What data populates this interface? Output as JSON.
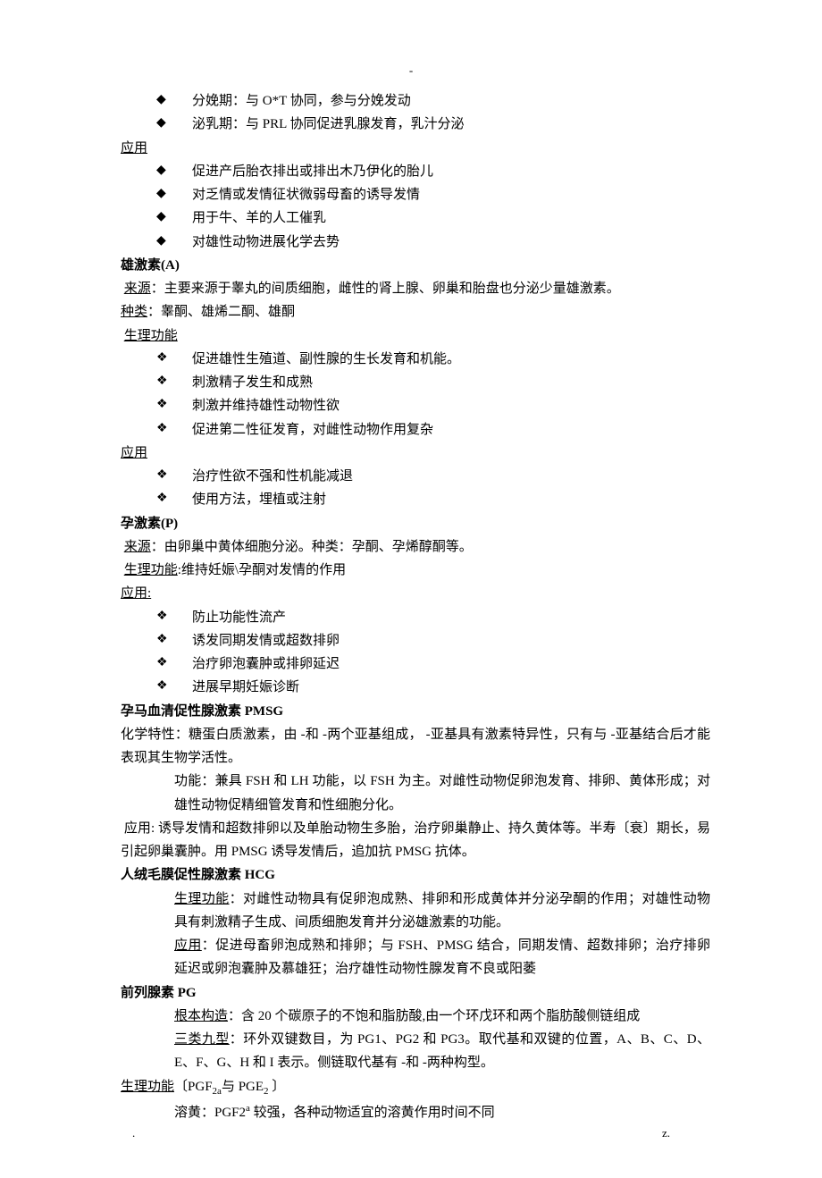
{
  "top_mark": "-",
  "bottom_left": ".",
  "bottom_right": "z.",
  "b1": "分娩期：与 O*T 协同，参与分娩发动",
  "b2": "泌乳期：与 PRL 协同促进乳腺发育，乳汁分泌",
  "app_label": "应用",
  "b3": "促进产后胎衣排出或排出木乃伊化的胎儿",
  "b4": "对乏情或发情征状微弱母畜的诱导发情",
  "b5": "用于牛、羊的人工催乳",
  "b6": "对雄性动物进展化学去势",
  "a_title": "雄激素(A)",
  "a_src_lbl": "来源",
  "a_src_txt": "：主要来源于睾丸的间质细胞，雌性的肾上腺、卵巢和胎盘也分泌少量雄激素。",
  "a_kind_lbl": "种类",
  "a_kind_txt": "：睾酮、雄烯二酮、雄酮",
  "phys_lbl": "生理功能",
  "as1": "促进雄性生殖道、副性腺的生长发育和机能。",
  "as2": "刺激精子发生和成熟",
  "as3": "刺激并维持雄性动物性欲",
  "as4": "促进第二性征发育，对雌性动物作用复杂",
  "aapp1": "治疗性欲不强和性机能减退",
  "aapp2": "使用方法，埋植或注射",
  "p_title": "孕激素(P)",
  "p_src_lbl": "来源",
  "p_src_txt": "：由卵巢中黄体细胞分泌。种类：孕酮、孕烯醇酮等。",
  "p_phys_lbl": "生理功能",
  "p_phys_txt": ":维持妊娠\\孕酮对发情的作用",
  "app_colon": "应用:",
  "ps1": "防止功能性流产",
  "ps2": "诱发同期发情或超数排卵",
  "ps3": "治疗卵泡囊肿或排卵延迟",
  "ps4": "进展早期妊娠诊断",
  "pmsg_title": "孕马血清促性腺激素 PMSG",
  "pmsg_chem": "化学特性：糖蛋白质激素，由 -和 -两个亚基组成， -亚基具有激素特异性，只有与 -亚基结合后才能表现其生物学活性。",
  "pmsg_func": "功能：兼具 FSH 和 LH 功能，以 FSH 为主。对雌性动物促卵泡发育、排卵、黄体形成；对雄性动物促精细管发育和性细胞分化。",
  "pmsg_app": "应用: 诱导发情和超数排卵以及单胎动物生多胎，治疗卵巢静止、持久黄体等。半寿〔衰〕期长，易引起卵巢囊肿。用 PMSG 诱导发情后，追加抗 PMSG 抗体。",
  "hcg_title": "人绒毛膜促性腺激素 HCG",
  "hcg_phys_lbl": "生理功能",
  "hcg_phys_txt": "：对雌性动物具有促卵泡成熟、排卵和形成黄体并分泌孕酮的作用；对雄性动物具有刺激精子生成、间质细胞发育并分泌雄激素的功能。",
  "hcg_app_lbl": "应用",
  "hcg_app_txt": "：促进母畜卵泡成熟和排卵；与 FSH、PMSG 结合，同期发情、超数排卵；治疗排卵延迟或卵泡囊肿及慕雄狂；治疗雄性动物性腺发育不良或阳萎",
  "pg_title": "前列腺素 PG",
  "pg_struct_lbl": "根本构造",
  "pg_struct_txt": "：含 20 个碳原子的不饱和脂肪酸,由一个环戊环和两个脂肪酸侧链组成",
  "pg_type_lbl": "三类九型",
  "pg_type_txt": "：环外双键数目，为 PG1、PG2 和 PG3。取代基和双键的位置，A、B、C、D、E、F、G、H 和 I 表示。侧链取代基有 -和 -两种构型。",
  "pg_phys_pre": "生理功能",
  "pg_phys_tail": "〔PGF",
  "pg_phys_sub1": "2a",
  "pg_phys_mid": "与 PGE",
  "pg_phys_sub2": "2",
  "pg_phys_end": " 〕",
  "pg_ry": "溶黄：PGF2",
  "pg_ry_sup": "a",
  "pg_ry_tail": " 较强，各种动物适宜的溶黄作用时间不同"
}
